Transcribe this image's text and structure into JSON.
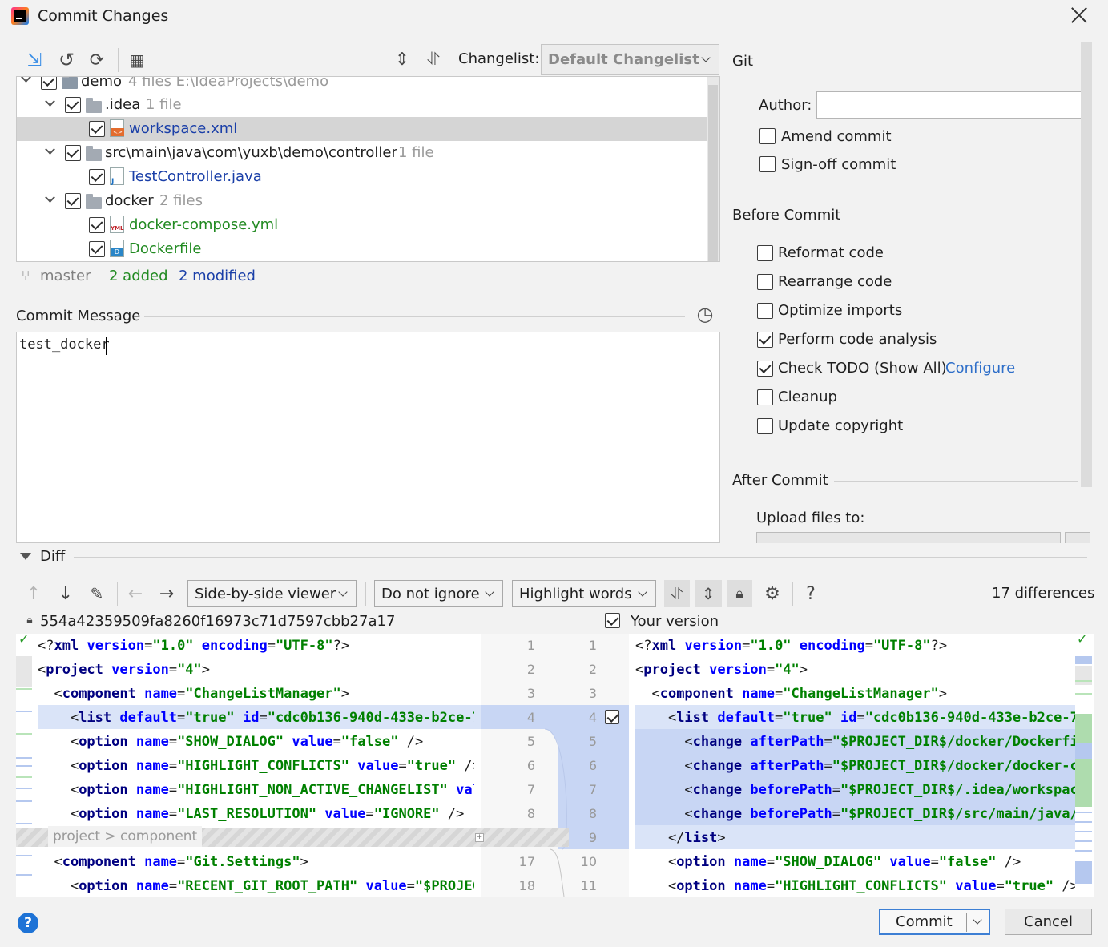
{
  "window": {
    "title": "Commit Changes"
  },
  "toolbar": {
    "changelist_label": "Changelist:",
    "changelist_value": "Default Changelist"
  },
  "tree": {
    "root": {
      "name": "demo",
      "meta": "4 files  E:\\IdeaProjects\\demo"
    },
    "idea_folder": {
      "name": ".idea",
      "meta": "1 file"
    },
    "workspace_file": {
      "name": "workspace.xml"
    },
    "controller_folder": {
      "name": "src\\main\\java\\com\\yuxb\\demo\\controller",
      "meta": "1 file"
    },
    "testcontroller_file": {
      "name": "TestController.java"
    },
    "docker_folder": {
      "name": "docker",
      "meta": "2 files"
    },
    "compose_file": {
      "name": "docker-compose.yml",
      "icon_text": "YML"
    },
    "dockerfile_file": {
      "name": "Dockerfile",
      "icon_text": "D"
    }
  },
  "status": {
    "branch": "master",
    "added": "2 added",
    "modified": "2 modified"
  },
  "commit_message": {
    "label": "Commit Message",
    "text": "test_docker"
  },
  "git": {
    "section": "Git",
    "author_label": "Author:",
    "author_value": "",
    "amend": "Amend commit",
    "signoff": "Sign-off commit"
  },
  "before_commit": {
    "section": "Before Commit",
    "items": [
      {
        "label": "Reformat code",
        "checked": false
      },
      {
        "label": "Rearrange code",
        "checked": false
      },
      {
        "label": "Optimize imports",
        "checked": false
      },
      {
        "label": "Perform code analysis",
        "checked": true
      },
      {
        "label": "Check TODO (Show All)",
        "checked": true
      },
      {
        "label": "Cleanup",
        "checked": false
      },
      {
        "label": "Update copyright",
        "checked": false
      }
    ],
    "configure_link": "Configure"
  },
  "after_commit": {
    "section": "After Commit",
    "upload_label": "Upload files to:"
  },
  "diff": {
    "section": "Diff",
    "viewer": "Side-by-side viewer",
    "ignore": "Do not ignore",
    "highlight": "Highlight words",
    "differences": "17 differences",
    "left_title": "554a42359509fa8260f16973c71d7597cbb27a17",
    "right_title": "Your version",
    "help_glyph": "?",
    "breadcrumb": "project > component",
    "left_numbers": [
      "1",
      "2",
      "3",
      "4",
      "5",
      "6",
      "7",
      "8",
      "17",
      "18"
    ],
    "right_numbers": [
      "1",
      "2",
      "3",
      "4",
      "5",
      "6",
      "7",
      "8",
      "9",
      "10",
      "11"
    ]
  },
  "buttons": {
    "commit": "Commit",
    "cancel": "Cancel",
    "help": "?"
  }
}
